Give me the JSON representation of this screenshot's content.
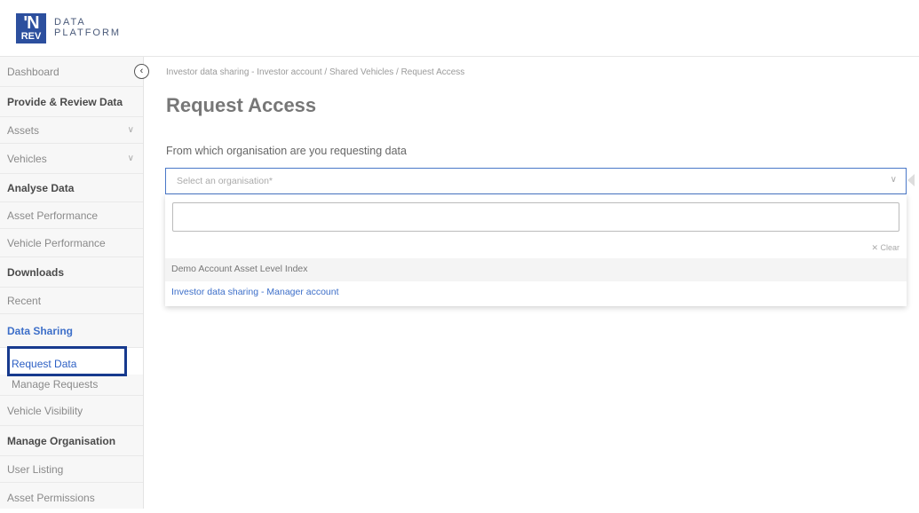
{
  "logo": {
    "line1": "'N",
    "line2": "REV"
  },
  "brand": {
    "line1": "DATA",
    "line2": "PLATFORM"
  },
  "sidebar": {
    "items": [
      {
        "label": "Dashboard"
      },
      {
        "label": "Provide & Review Data"
      },
      {
        "label": "Assets",
        "chevron": "∨"
      },
      {
        "label": "Vehicles",
        "chevron": "∨"
      },
      {
        "label": "Analyse Data"
      },
      {
        "label": "Asset Performance"
      },
      {
        "label": "Vehicle Performance"
      },
      {
        "label": "Downloads"
      },
      {
        "label": "Recent"
      },
      {
        "label": "Data Sharing"
      },
      {
        "label": "Request Data"
      },
      {
        "label": "Manage Requests"
      },
      {
        "label": "Vehicle Visibility"
      },
      {
        "label": "Manage Organisation"
      },
      {
        "label": "User Listing"
      },
      {
        "label": "Asset Permissions"
      }
    ]
  },
  "collapse_glyph": "‹",
  "main": {
    "breadcrumb": "Investor data sharing - Investor account / Shared Vehicles / Request Access",
    "title": "Request Access",
    "question": "From which organisation are you requesting data",
    "select": {
      "placeholder": "Select an organisation*",
      "chevron": "∨"
    },
    "dropdown": {
      "search_value": "",
      "clear_label": "✕ Clear",
      "options": [
        "Demo Account Asset Level Index",
        "Investor data sharing - Manager account"
      ]
    }
  },
  "colors": {
    "accent": "#3d6fc9",
    "logo_bg": "#2c4f9e",
    "highlight": "#173a8e"
  }
}
